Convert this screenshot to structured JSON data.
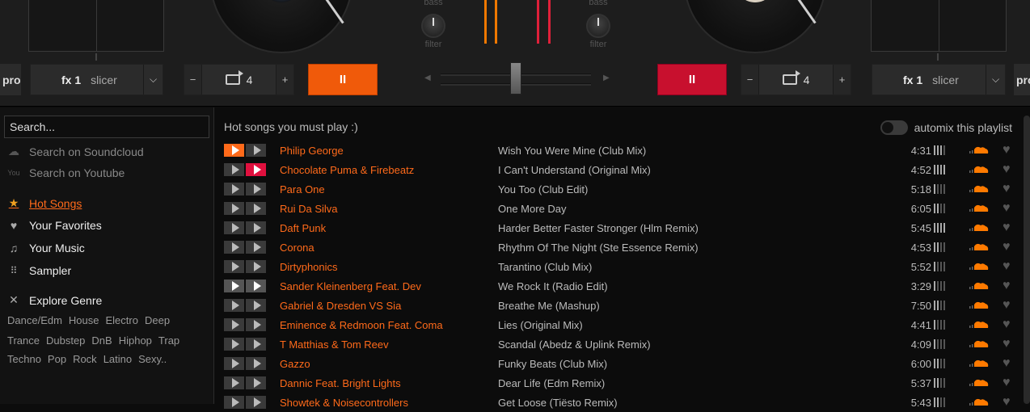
{
  "decks": {
    "left": {
      "pro_label": "pro",
      "fx": {
        "label": "fx 1",
        "name": "slicer"
      },
      "loop": {
        "minus": "−",
        "value": "4",
        "plus": "+"
      },
      "play_symbol": "II",
      "play_color": "#f05a0a"
    },
    "right": {
      "pro_label": "pro",
      "fx": {
        "label": "fx 1",
        "name": "slicer"
      },
      "loop": {
        "minus": "−",
        "value": "4",
        "plus": "+"
      },
      "play_symbol": "II",
      "play_color": "#c8102e"
    }
  },
  "mixer": {
    "left": {
      "bass_label": "bass",
      "filter_label": "filter"
    },
    "right": {
      "bass_label": "bass",
      "filter_label": "filter"
    },
    "vu_left_color": "#f07800",
    "vu_right_color": "#e0203a"
  },
  "sidebar": {
    "search_placeholder": "Search...",
    "search_sources": [
      {
        "label": "Search on Soundcloud",
        "icon": "cloud-icon"
      },
      {
        "label": "Search on Youtube",
        "icon": "youtube-icon"
      }
    ],
    "items": [
      {
        "label": "Hot Songs",
        "icon": "star-icon",
        "active": true
      },
      {
        "label": "Your Favorites",
        "icon": "heart-icon"
      },
      {
        "label": "Your Music",
        "icon": "music-note-icon"
      },
      {
        "label": "Sampler",
        "icon": "grid-icon"
      }
    ],
    "explore": {
      "label": "Explore Genre",
      "icon": "shuffle-icon"
    },
    "genres": [
      [
        "Dance/Edm",
        "House",
        "Electro",
        "Deep"
      ],
      [
        "Trance",
        "Dubstep",
        "DnB",
        "Hiphop",
        "Trap"
      ],
      [
        "Techno",
        "Pop",
        "Rock",
        "Latino",
        "Sexy.."
      ]
    ]
  },
  "playlist": {
    "title": "Hot songs you must play :)",
    "automix_label": "automix this playlist",
    "tracks": [
      {
        "artist": "Philip George",
        "title": "Wish You Were Mine (Club Mix)",
        "duration": "4:31",
        "deck": "left",
        "bpm": 3
      },
      {
        "artist": "Chocolate Puma & Firebeatz",
        "title": "I Can't Understand (Original Mix)",
        "duration": "4:52",
        "deck": "right",
        "bpm": 4
      },
      {
        "artist": "Para One",
        "title": "You Too (Club Edit)",
        "duration": "5:18",
        "deck": "",
        "bpm": 1
      },
      {
        "artist": "Rui Da Silva",
        "title": "One More Day",
        "duration": "6:05",
        "deck": "",
        "bpm": 2
      },
      {
        "artist": "Daft Punk",
        "title": "Harder Better Faster Stronger (Hlm Remix)",
        "duration": "5:45",
        "deck": "",
        "bpm": 4
      },
      {
        "artist": "Corona",
        "title": "Rhythm Of The Night (Ste Essence Remix)",
        "duration": "4:53",
        "deck": "",
        "bpm": 2
      },
      {
        "artist": "Dirtyphonics",
        "title": "Tarantino (Club Mix)",
        "duration": "5:52",
        "deck": "",
        "bpm": 1
      },
      {
        "artist": "Sander Kleinenberg Feat. Dev",
        "title": "We Rock It (Radio Edit)",
        "duration": "3:29",
        "deck": "both",
        "bpm": 1
      },
      {
        "artist": "Gabriel & Dresden VS Sia",
        "title": "Breathe Me (Mashup)",
        "duration": "7:50",
        "deck": "",
        "bpm": 2
      },
      {
        "artist": "Eminence & Redmoon Feat. Coma",
        "title": "Lies (Original Mix)",
        "duration": "4:41",
        "deck": "",
        "bpm": 1
      },
      {
        "artist": "T Matthias & Tom Reev",
        "title": "Scandal (Abedz & Uplink Remix)",
        "duration": "4:09",
        "deck": "",
        "bpm": 1
      },
      {
        "artist": "Gazzo",
        "title": "Funky Beats (Club Mix)",
        "duration": "6:00",
        "deck": "",
        "bpm": 2
      },
      {
        "artist": "Dannic Feat. Bright Lights",
        "title": "Dear Life (Edm Remix)",
        "duration": "5:37",
        "deck": "",
        "bpm": 2
      },
      {
        "artist": "Showtek & Noisecontrollers",
        "title": "Get Loose (Tiësto Remix)",
        "duration": "5:43",
        "deck": "",
        "bpm": 2
      }
    ]
  },
  "colors": {
    "accent_orange": "#ff6a1a",
    "accent_red": "#e0103e",
    "soundcloud": "#ff7a00"
  }
}
